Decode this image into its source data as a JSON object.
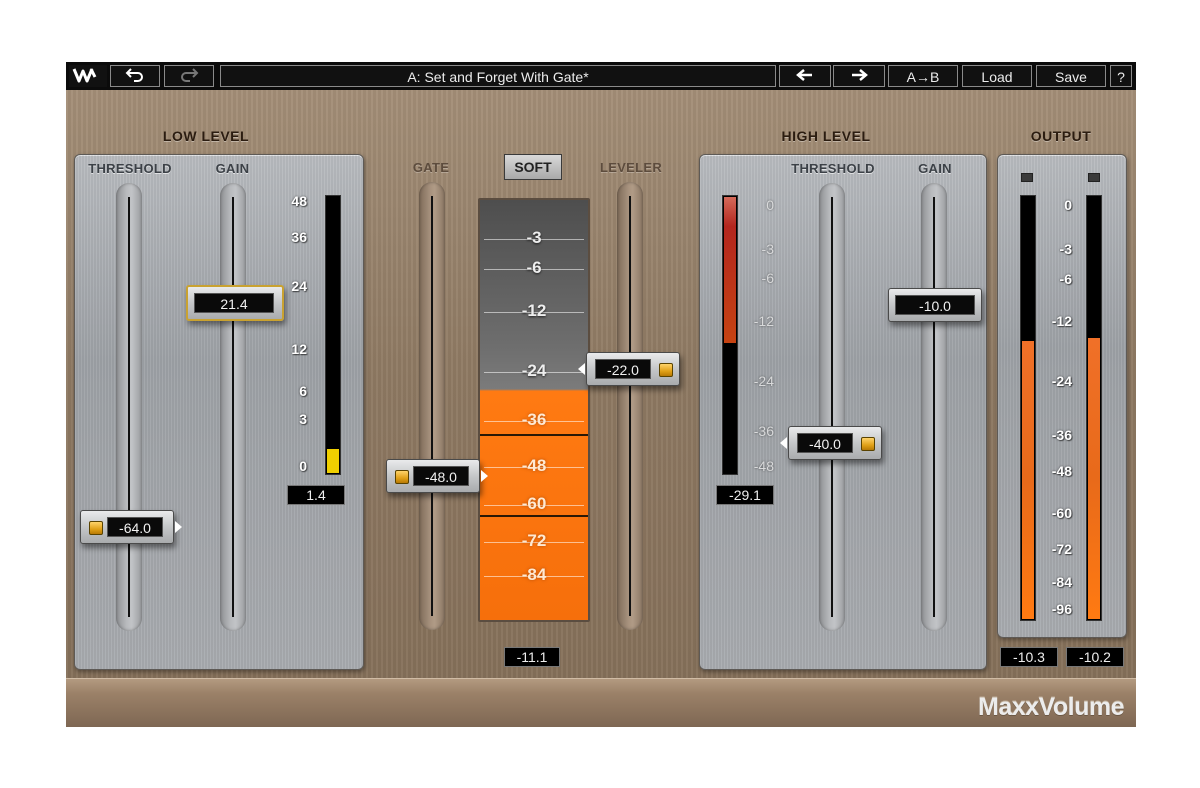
{
  "toolbar": {
    "logo_icon": "waves-logo-icon",
    "undo_icon": "undo-icon",
    "redo_icon": "redo-icon",
    "preset_name": "A: Set and Forget With Gate*",
    "prev_icon": "arrow-left-icon",
    "next_icon": "arrow-right-icon",
    "ab_label": "A→B",
    "load_label": "Load",
    "save_label": "Save",
    "help_label": "?"
  },
  "low_level": {
    "title": "LOW LEVEL",
    "threshold_label": "THRESHOLD",
    "gain_label": "GAIN",
    "threshold_value": "-64.0",
    "gain_value": "21.4",
    "meter_value": "1.4",
    "meter_level_db": 1.4,
    "scale": [
      "48",
      "36",
      "24",
      "12",
      "6",
      "3",
      "0"
    ]
  },
  "gate": {
    "label": "GATE",
    "value": "-48.0"
  },
  "mode_button": "SOFT",
  "leveler": {
    "label": "LEVELER",
    "value": "-22.0",
    "meter_value": "-11.1",
    "scale": [
      "-3",
      "-6",
      "-12",
      "-24",
      "-36",
      "-48",
      "-60",
      "-72",
      "-84"
    ]
  },
  "high_level": {
    "title": "HIGH LEVEL",
    "threshold_label": "THRESHOLD",
    "gain_label": "GAIN",
    "threshold_value": "-40.0",
    "gain_value": "-10.0",
    "meter_value": "-29.1",
    "scale": [
      "0",
      "-3",
      "-6",
      "-12",
      "-24",
      "-36",
      "-48"
    ]
  },
  "output": {
    "title": "OUTPUT",
    "left_value": "-10.3",
    "right_value": "-10.2",
    "scale": [
      "0",
      "-3",
      "-6",
      "-12",
      "-24",
      "-36",
      "-48",
      "-60",
      "-72",
      "-84",
      "-96"
    ]
  },
  "brand": "MaxxVolume",
  "colors": {
    "accent_orange": "#ff7a12",
    "meter_yellow": "#f0d000",
    "meter_red": "#b3261e",
    "handle_led": "#e0a017"
  }
}
